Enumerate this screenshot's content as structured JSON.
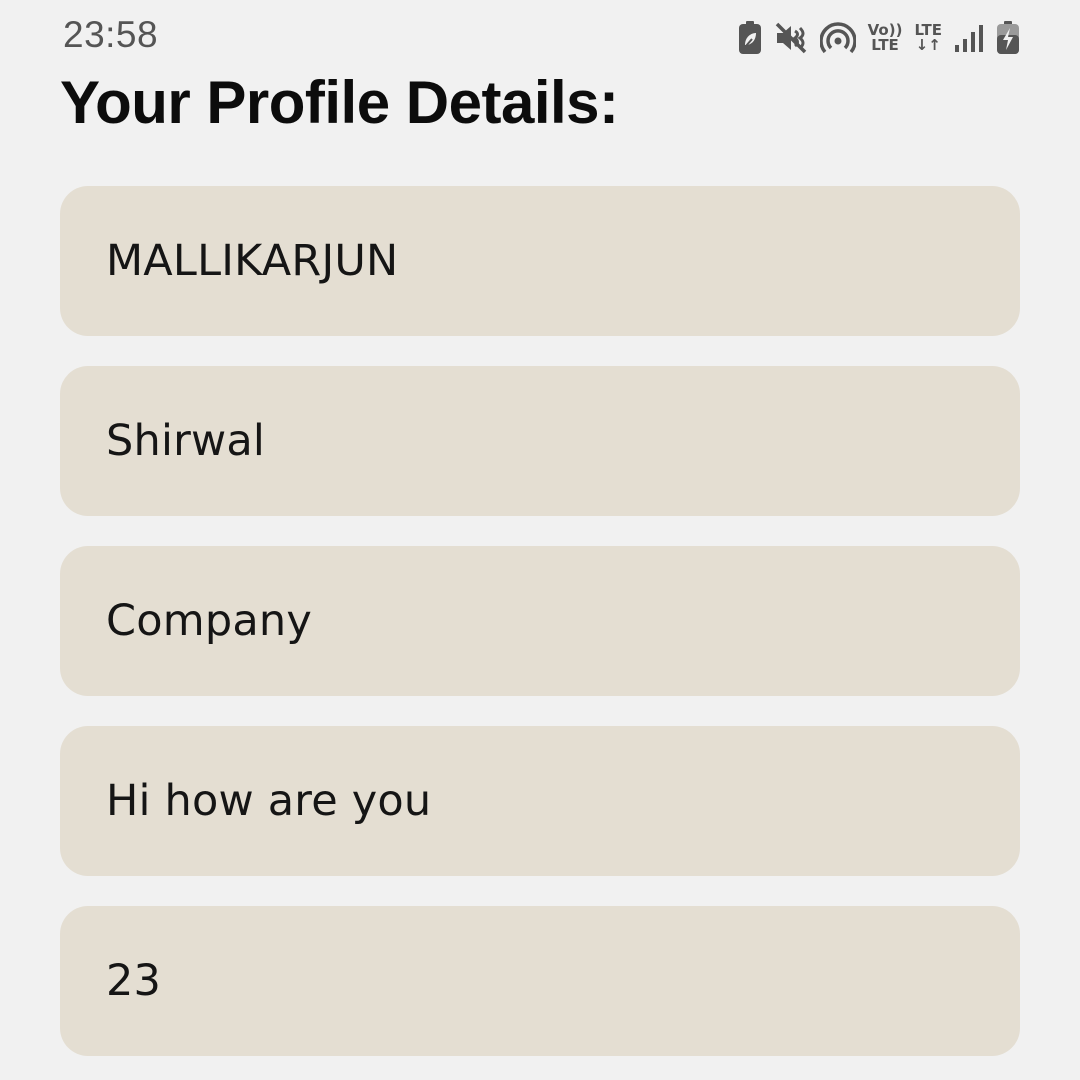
{
  "status_bar": {
    "time": "23:58",
    "volte_top": "Vo))",
    "volte_bottom": "LTE",
    "lte_top": "LTE",
    "lte_bottom": "↓↑",
    "icons": [
      "battery-saver-icon",
      "mute-icon",
      "hotspot-icon",
      "volte-icon",
      "lte-data-icon",
      "signal-icon",
      "battery-charging-icon"
    ]
  },
  "page": {
    "title": "Your Profile Details:"
  },
  "profile": {
    "fields": [
      {
        "value": "MALLIKARJUN"
      },
      {
        "value": "Shirwal"
      },
      {
        "value": "Company"
      },
      {
        "value": "Hi how are you"
      },
      {
        "value": "23"
      }
    ]
  },
  "colors": {
    "background": "#f1f1f1",
    "field_background": "#e4ded2",
    "text": "#151515",
    "status_icons": "#555555"
  }
}
